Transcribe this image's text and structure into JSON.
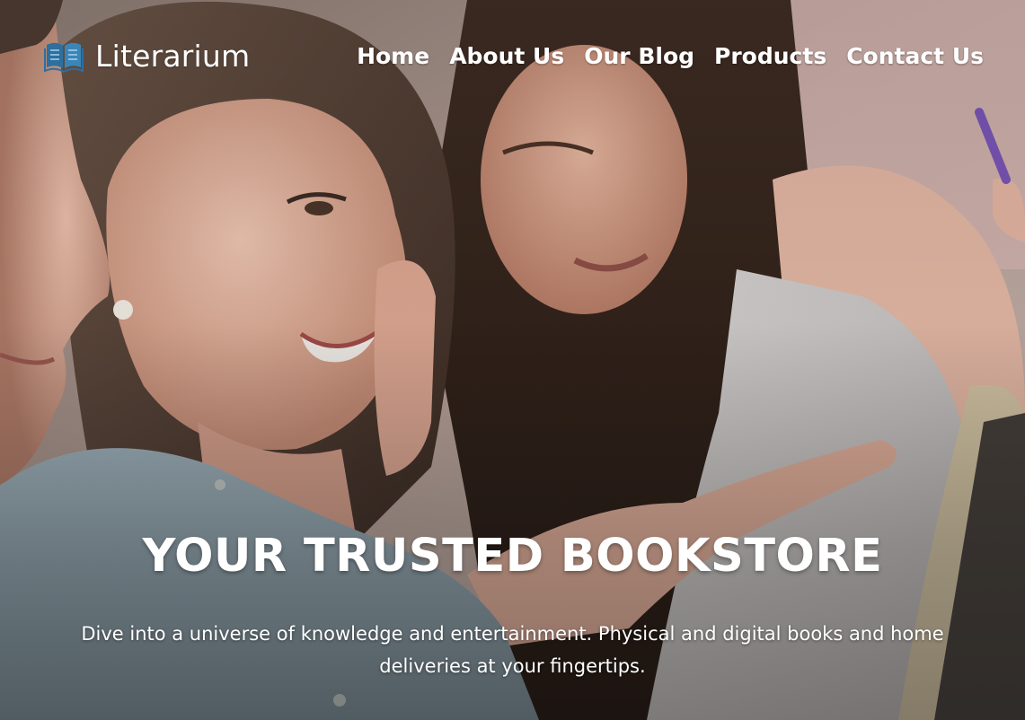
{
  "brand": {
    "name": "Literarium",
    "logo_icon": "open-book-icon"
  },
  "nav": {
    "items": [
      {
        "label": "Home"
      },
      {
        "label": "About Us"
      },
      {
        "label": "Our Blog"
      },
      {
        "label": "Products"
      },
      {
        "label": "Contact Us"
      }
    ]
  },
  "hero": {
    "title": "YOUR TRUSTED BOOKSTORE",
    "subtitle": "Dive into a universe of knowledge and entertainment. Physical and digital books and home deliveries at your fingertips.",
    "image_subject": "smiling women looking at a tablet"
  },
  "colors": {
    "text": "#ffffff",
    "logo_accent": "#2d6f9e"
  }
}
